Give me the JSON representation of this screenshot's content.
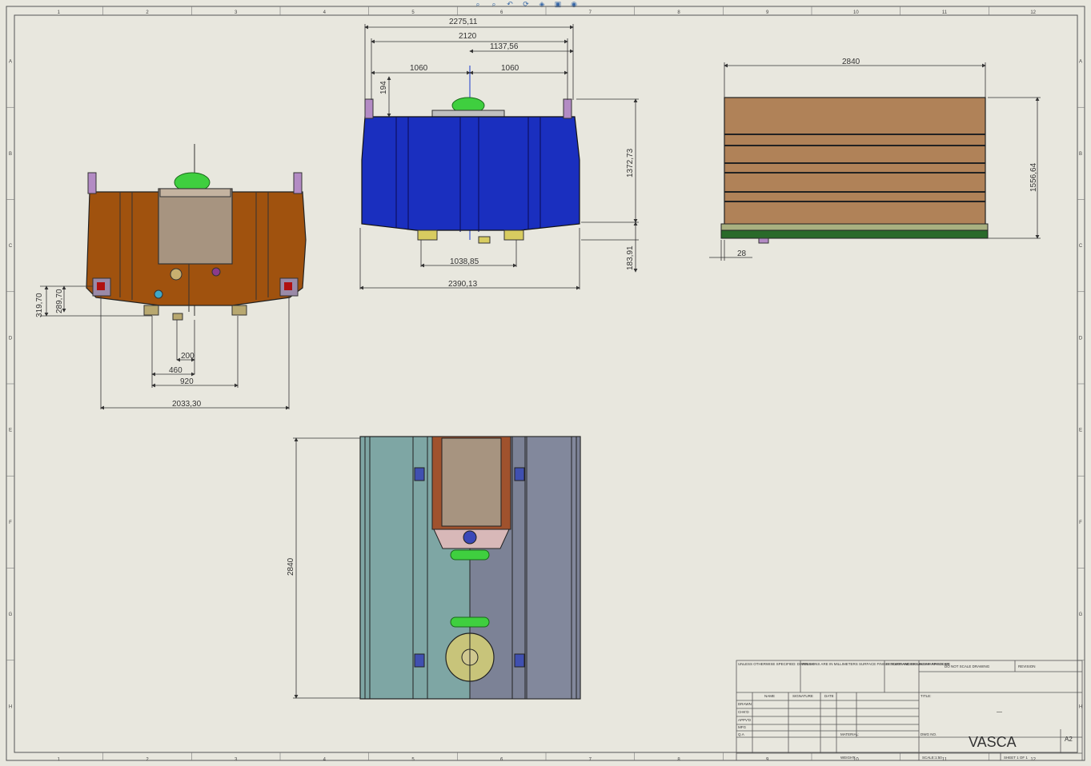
{
  "toolbar": {
    "buttons": [
      "zoom-to-fit",
      "zoom-to-area",
      "previous-view",
      "rotate-view",
      "view-orientation",
      "display-style",
      "hide-show-items"
    ]
  },
  "border": {
    "col_labels": [
      "1",
      "2",
      "3",
      "4",
      "5",
      "6",
      "7",
      "8",
      "9",
      "10",
      "11",
      "12"
    ],
    "row_labels": [
      "A",
      "B",
      "C",
      "D",
      "E",
      "F",
      "G",
      "H"
    ]
  },
  "front_view": {
    "dims": {
      "h1": "319,70",
      "h2": "289,70",
      "d200": "200",
      "d460": "460",
      "d920": "920",
      "d2033": "2033,30"
    }
  },
  "top_view": {
    "dims": {
      "w1": "2275,11",
      "w2": "2120",
      "w3": "1137,56",
      "w4l": "1060",
      "w4r": "1060",
      "h194": "194",
      "h1372": "1372,73",
      "h183": "183,91",
      "w1038": "1038,85",
      "w2390": "2390,13"
    }
  },
  "side_view": {
    "dims": {
      "w2840": "2840",
      "h1556": "1556,64",
      "d28": "28"
    }
  },
  "plan_view": {
    "dims": {
      "h2840": "2840"
    }
  },
  "title_block": {
    "notes": "UNLESS OTHERWISE SPECIFIED: DIMENSIONS ARE IN MILLIMETERS SURFACE FINISH: TOLERANCES: LINEAR: ANGULAR:",
    "finish": "FINISH",
    "deburr": "DEBURR AND BREAK SHARP EDGES",
    "do_not_scale": "DO NOT SCALE DRAWING",
    "revision": "REVISION",
    "col_name": "NAME",
    "col_signature": "SIGNATURE",
    "col_date": "DATE",
    "title_label": "TITLE:",
    "rows": [
      "DRAWN",
      "CHK'D",
      "APPV'D",
      "MFG",
      "Q.A"
    ],
    "material": "MATERIAL:",
    "dwg_no": "DWG NO.",
    "part_name": "VASCA",
    "size": "A2",
    "weight": "WEIGHT:",
    "scale": "SCALE:1:50",
    "sheet": "SHEET 1 OF 1",
    "dash": "—"
  }
}
